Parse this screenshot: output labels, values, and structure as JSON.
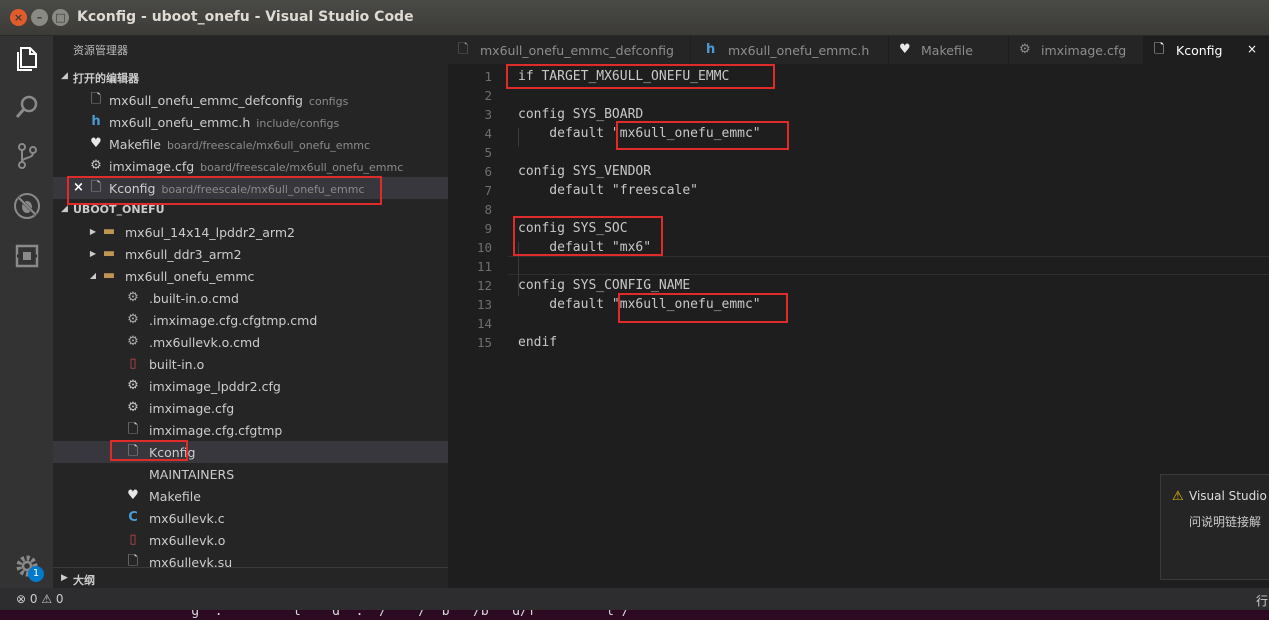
{
  "window": {
    "title": "Kconfig - uboot_onefu - Visual Studio Code",
    "close_glyph": "×",
    "min_glyph": "–",
    "max_glyph": "□"
  },
  "activity": {
    "settings_badge": "1"
  },
  "sidebar": {
    "title": "资源管理器",
    "open_editors_label": "打开的编辑器",
    "open_editors": [
      {
        "name": "mx6ull_onefu_emmc_defconfig",
        "desc": "configs",
        "icon": "file-icon"
      },
      {
        "name": "mx6ull_onefu_emmc.h",
        "desc": "include/configs",
        "icon": "h-file-icon"
      },
      {
        "name": "Makefile",
        "desc": "board/freescale/mx6ull_onefu_emmc",
        "icon": "heart-icon"
      },
      {
        "name": "imximage.cfg",
        "desc": "board/freescale/mx6ull_onefu_emmc",
        "icon": "gear-icon"
      },
      {
        "name": "Kconfig",
        "desc": "board/freescale/mx6ull_onefu_emmc",
        "icon": "file-icon",
        "close": "×"
      }
    ],
    "project_label": "UBOOT_ONEFU",
    "tree": [
      {
        "name": "mx6ul_14x14_lpddr2_arm2",
        "type": "folder",
        "caret": "▶"
      },
      {
        "name": "mx6ull_ddr3_arm2",
        "type": "folder",
        "caret": "▶"
      },
      {
        "name": "mx6ull_onefu_emmc",
        "type": "folder-open",
        "caret": "◢"
      },
      {
        "name": ".built-in.o.cmd",
        "type": "gears"
      },
      {
        "name": ".imximage.cfg.cfgtmp.cmd",
        "type": "gears"
      },
      {
        "name": ".mx6ullevk.o.cmd",
        "type": "gears"
      },
      {
        "name": "built-in.o",
        "type": "binary"
      },
      {
        "name": "imximage_lpddr2.cfg",
        "type": "gear"
      },
      {
        "name": "imximage.cfg",
        "type": "gear"
      },
      {
        "name": "imximage.cfg.cfgtmp",
        "type": "file"
      },
      {
        "name": "Kconfig",
        "type": "file"
      },
      {
        "name": "MAINTAINERS",
        "type": "none"
      },
      {
        "name": "Makefile",
        "type": "heart"
      },
      {
        "name": "mx6ullevk.c",
        "type": "c"
      },
      {
        "name": "mx6ullevk.o",
        "type": "binary"
      },
      {
        "name": "mx6ullevk.su",
        "type": "file"
      }
    ],
    "outline_label": "大纲"
  },
  "tabs": [
    {
      "label": "mx6ull_onefu_emmc_defconfig",
      "icon": "file-icon",
      "active": false
    },
    {
      "label": "mx6ull_onefu_emmc.h",
      "icon": "h-file-icon",
      "active": false
    },
    {
      "label": "Makefile",
      "icon": "heart-icon",
      "active": false
    },
    {
      "label": "imximage.cfg",
      "icon": "gear-icon",
      "active": false
    },
    {
      "label": "Kconfig",
      "icon": "file-icon",
      "active": true,
      "close": "×"
    }
  ],
  "editor": {
    "lines": [
      {
        "n": "1",
        "text": "if TARGET_MX6ULL_ONEFU_EMMC"
      },
      {
        "n": "2",
        "text": ""
      },
      {
        "n": "3",
        "text": "config SYS_BOARD"
      },
      {
        "n": "4",
        "text": "    default \"mx6ull_onefu_emmc\""
      },
      {
        "n": "5",
        "text": ""
      },
      {
        "n": "6",
        "text": "config SYS_VENDOR"
      },
      {
        "n": "7",
        "text": "    default \"freescale\""
      },
      {
        "n": "8",
        "text": ""
      },
      {
        "n": "9",
        "text": "config SYS_SOC"
      },
      {
        "n": "10",
        "text": "    default \"mx6\""
      },
      {
        "n": "11",
        "text": ""
      },
      {
        "n": "12",
        "text": "config SYS_CONFIG_NAME"
      },
      {
        "n": "13",
        "text": "    default \"mx6ull_onefu_emmc\""
      },
      {
        "n": "14",
        "text": ""
      },
      {
        "n": "15",
        "text": "endif"
      }
    ]
  },
  "notification": {
    "line1": "Visual Studio",
    "line2": "问说明链接解",
    "icon": "warning-icon"
  },
  "status": {
    "problems": "⊗ 0  ⚠ 0",
    "position": "行"
  },
  "terminal": {
    "text": "    g  :         l    d  :  /    /  b   /b   d/f         l /"
  },
  "colors": {
    "highlight": "#e02b2b",
    "accent": "#007acc",
    "title_close": "#e25b2b"
  }
}
